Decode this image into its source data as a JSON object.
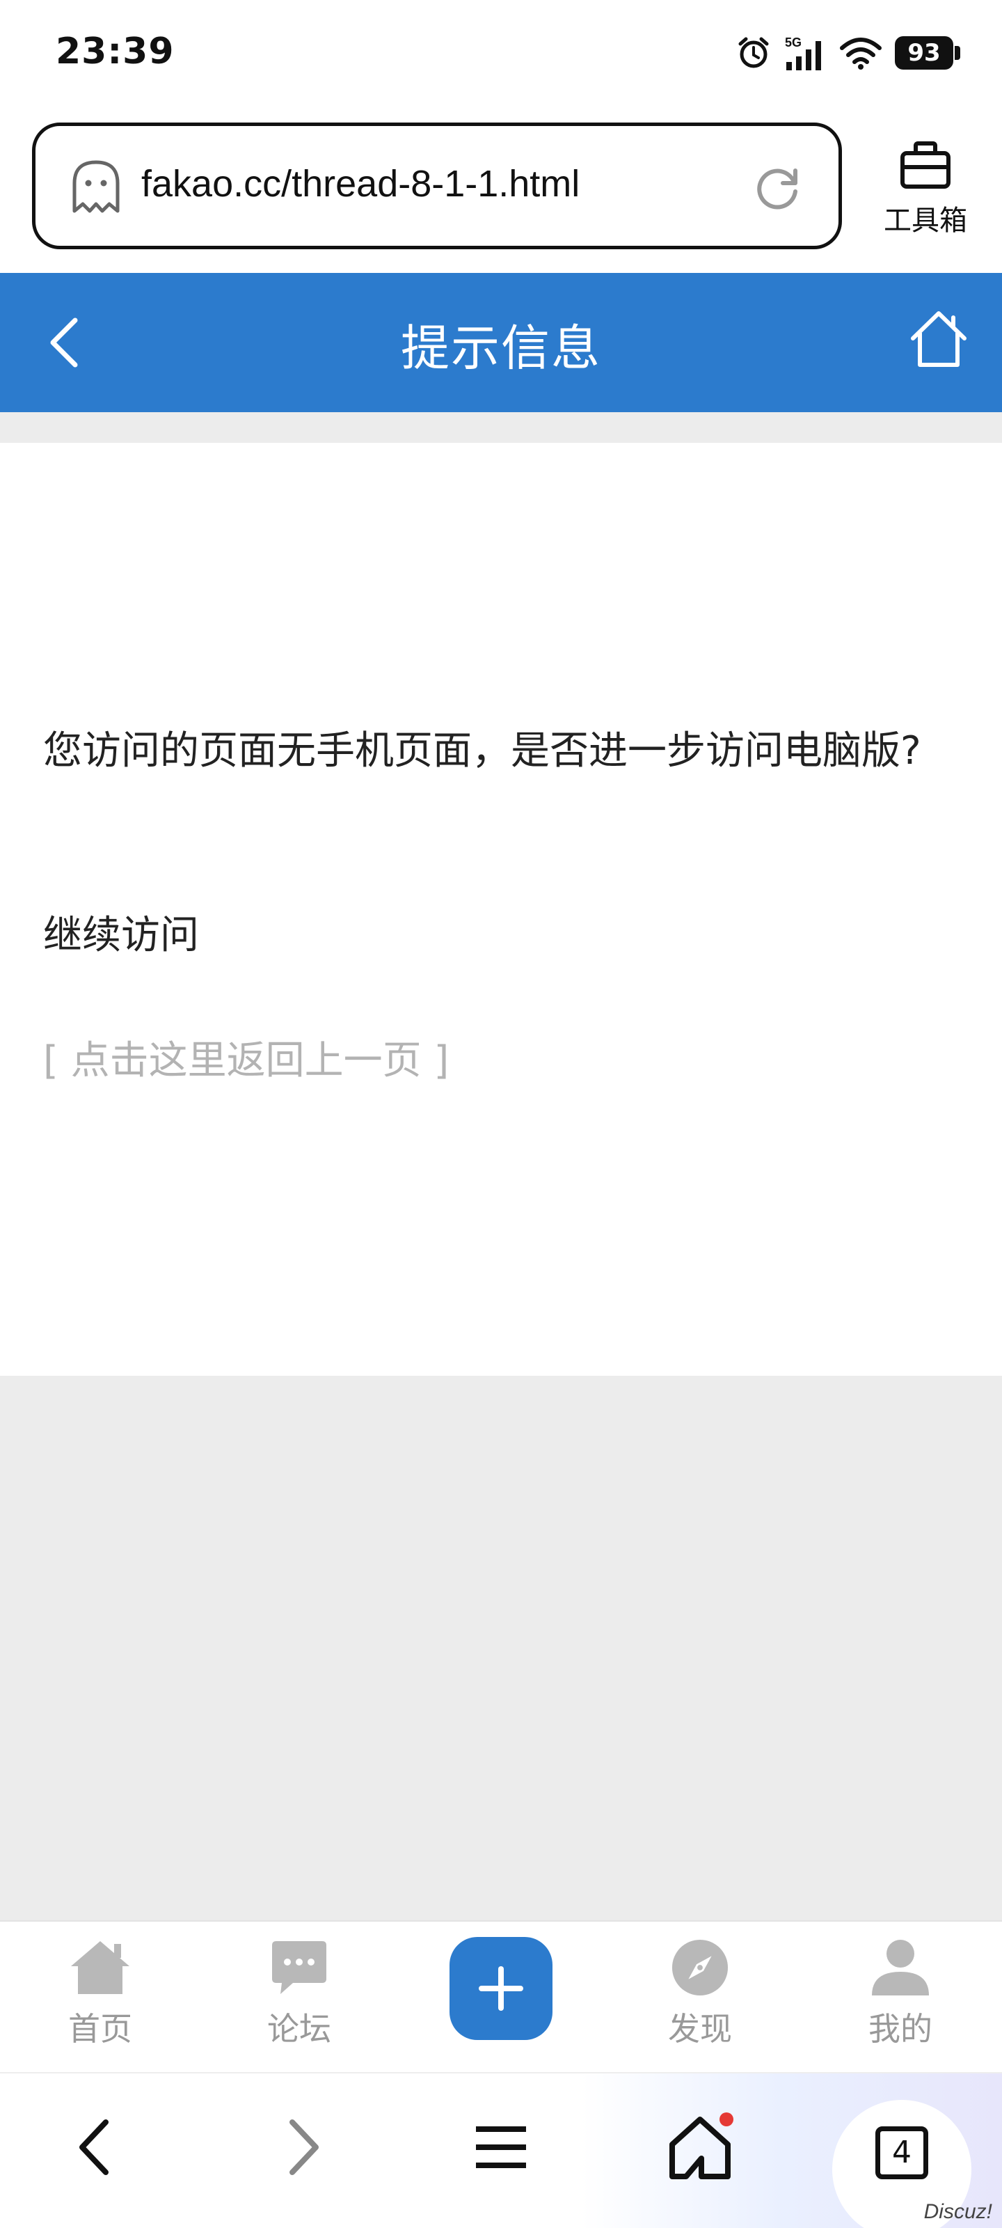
{
  "status_bar": {
    "time": "23:39",
    "network": "5G",
    "battery": "93"
  },
  "address_bar": {
    "url": "fakao.cc/thread-8-1-1.html"
  },
  "toolbox": {
    "label": "工具箱"
  },
  "header": {
    "title": "提示信息"
  },
  "content": {
    "message": "您访问的页面无手机页面，是否进一步访问电脑版?",
    "continue_link": "继续访问",
    "back_link": "[ 点击这里返回上一页 ]"
  },
  "site_nav": {
    "items": [
      {
        "label": "首页",
        "icon": "home-icon"
      },
      {
        "label": "论坛",
        "icon": "chat-bubble-icon"
      },
      {
        "label": "",
        "icon": "plus-icon"
      },
      {
        "label": "发现",
        "icon": "compass-icon"
      },
      {
        "label": "我的",
        "icon": "user-icon"
      }
    ]
  },
  "browser_bar": {
    "tab_count": "4",
    "watermark": "Discuz!"
  },
  "colors": {
    "accent": "#2c7bcd",
    "nav_grey": "#999999",
    "link_grey": "#b3b3b3",
    "background_grey": "#ececec",
    "notification_dot": "#e53935"
  }
}
